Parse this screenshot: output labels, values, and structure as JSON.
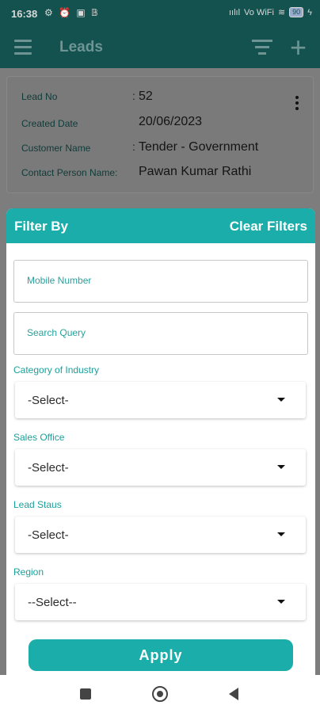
{
  "status": {
    "time": "16:38",
    "left_icons": "⚙ ⏰ ▣ 𝔹",
    "signal": "ıılıl",
    "network": "Vo WiFi",
    "battery": "90"
  },
  "appbar": {
    "title": "Leads"
  },
  "lead": {
    "lead_no_label": "Lead No",
    "lead_no": "52",
    "created_label": "Created Date",
    "created": "20/06/2023",
    "customer_label": "Customer Name",
    "customer": "Tender - Government",
    "contact_label": "Contact Person Name:",
    "contact": "Pawan Kumar Rathi"
  },
  "filter": {
    "title": "Filter By",
    "clear": "Clear Filters",
    "mobile_placeholder": "Mobile Number",
    "search_placeholder": "Search Query",
    "industry_label": "Category of Industry",
    "industry_value": "-Select-",
    "office_label": "Sales Office",
    "office_value": "-Select-",
    "status_label": "Lead Staus",
    "status_value": "-Select-",
    "region_label": "Region",
    "region_value": "--Select--",
    "apply": "Apply"
  },
  "colors": {
    "primary": "#1bada9",
    "appbar": "#13524f"
  }
}
